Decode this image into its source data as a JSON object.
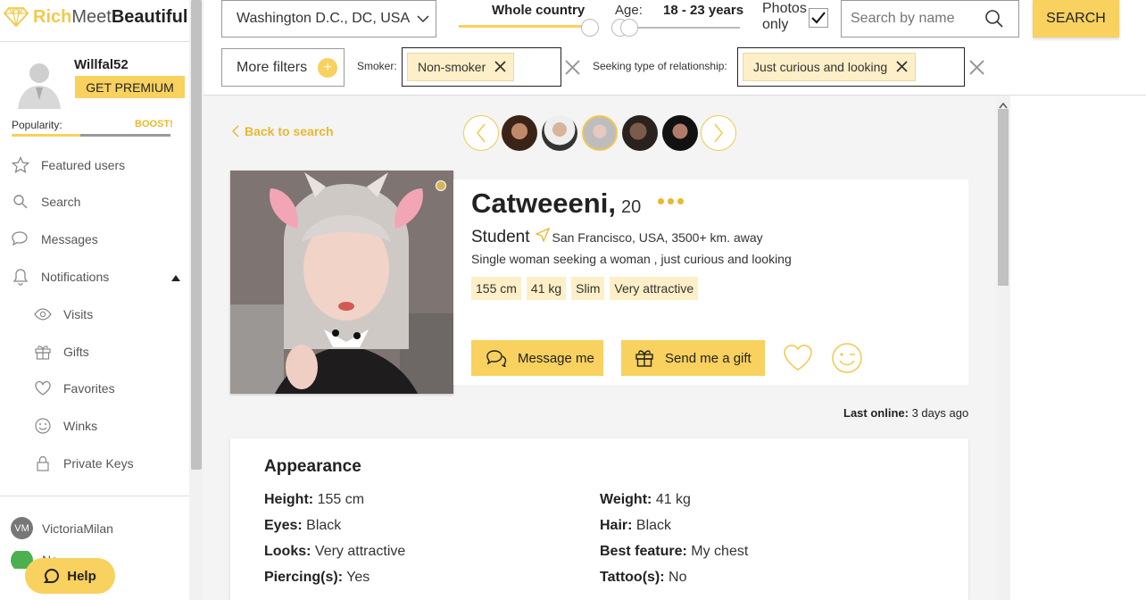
{
  "logo": {
    "rich": "Rich",
    "meet": "Meet",
    "beautiful": "Beautiful"
  },
  "user": {
    "name": "Willfal52",
    "premium_label": "GET PREMIUM",
    "popularity_label": "Popularity:",
    "boost_label": "BOOST!",
    "popularity_level": 0.43
  },
  "sidebar": {
    "items": [
      {
        "label": "Featured users",
        "icon": "star-icon"
      },
      {
        "label": "Search",
        "icon": "search-icon"
      },
      {
        "label": "Messages",
        "icon": "chat-icon"
      },
      {
        "label": "Notifications",
        "icon": "bell-icon"
      }
    ],
    "sub_items": [
      {
        "label": "Visits",
        "icon": "eye-icon"
      },
      {
        "label": "Gifts",
        "icon": "gift-icon"
      },
      {
        "label": "Favorites",
        "icon": "heart-icon"
      },
      {
        "label": "Winks",
        "icon": "smiley-icon"
      },
      {
        "label": "Private Keys",
        "icon": "lock-icon"
      }
    ],
    "partners": [
      {
        "label": "VictoriaMilan",
        "badge": "VM"
      },
      {
        "label": "Ne..."
      }
    ],
    "help_label": "Help"
  },
  "filters": {
    "location": "Washington D.C., DC, USA",
    "scope_label": "Whole country",
    "age_label": "Age:",
    "age_value": "18 - 23 years",
    "photos_only_label_1": "Photos",
    "photos_only_label_2": "only",
    "photos_only_checked": true,
    "search_placeholder": "Search by name",
    "search_button": "SEARCH",
    "more_filters": "More filters",
    "smoker_label": "Smoker:",
    "smoker_chip": "Non-smoker",
    "relationship_label": "Seeking type of relationship:",
    "relationship_chip": "Just curious and looking"
  },
  "profile": {
    "back_label": "Back to search",
    "name": "Catweeeni,",
    "age": "20",
    "occupation": "Student",
    "location": "San Francisco, USA, 3500+ km. away",
    "seeking": "Single woman seeking a woman , just curious and looking",
    "tags": [
      "155 cm",
      "41 kg",
      "Slim",
      "Very attractive"
    ],
    "message_button": "Message me",
    "gift_button": "Send me a gift",
    "last_online_label": "Last online:",
    "last_online_value": "3 days ago"
  },
  "appearance": {
    "title": "Appearance",
    "left": [
      {
        "label": "Height:",
        "value": "155 cm"
      },
      {
        "label": "Eyes:",
        "value": "Black"
      },
      {
        "label": "Looks:",
        "value": "Very attractive"
      },
      {
        "label": "Piercing(s):",
        "value": "Yes"
      }
    ],
    "right": [
      {
        "label": "Weight:",
        "value": "41 kg"
      },
      {
        "label": "Hair:",
        "value": "Black"
      },
      {
        "label": "Best feature:",
        "value": "My chest"
      },
      {
        "label": "Tattoo(s):",
        "value": "No"
      }
    ]
  },
  "colors": {
    "accent": "#f8d15e",
    "tag_bg": "#fdefc7"
  }
}
